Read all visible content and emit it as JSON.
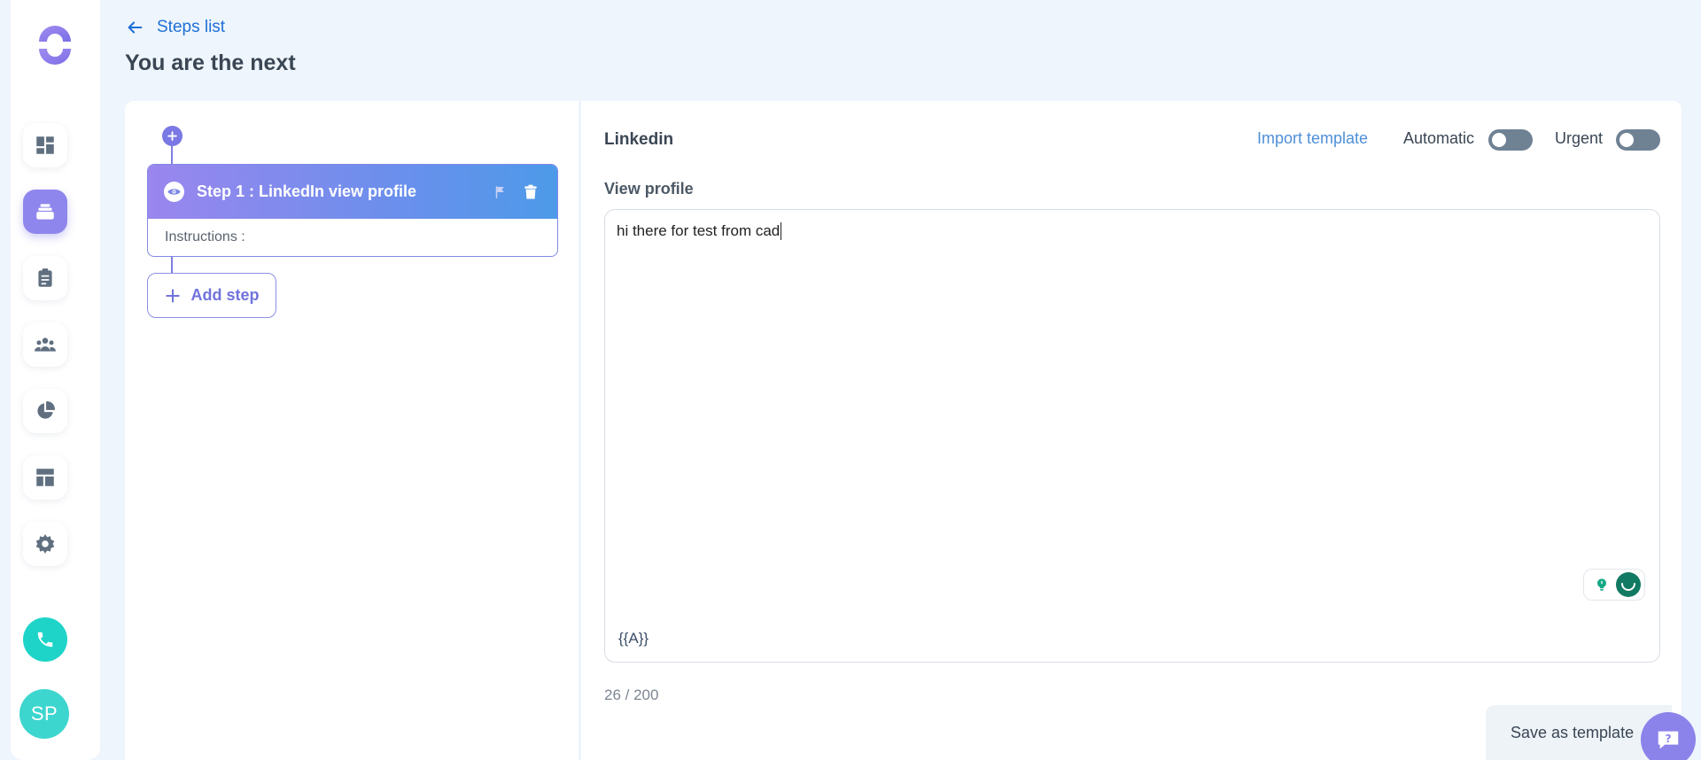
{
  "header": {
    "back_label": "Steps list",
    "title": "You are the next"
  },
  "sidebar": {
    "items": [
      {
        "name": "dashboard-icon",
        "active": false
      },
      {
        "name": "sequences-icon",
        "active": true
      },
      {
        "name": "tasks-icon",
        "active": false
      },
      {
        "name": "contacts-icon",
        "active": false
      },
      {
        "name": "reports-icon",
        "active": false
      },
      {
        "name": "templates-icon",
        "active": false
      },
      {
        "name": "settings-icon",
        "active": false
      }
    ],
    "avatar_initials": "SP"
  },
  "steps": {
    "items": [
      {
        "title": "Step 1 : LinkedIn view profile",
        "instructions_label": "Instructions :"
      }
    ],
    "add_step_label": "Add step"
  },
  "editor": {
    "channel": "Linkedin",
    "import_template_label": "Import template",
    "automatic_label": "Automatic",
    "automatic_on": false,
    "urgent_label": "Urgent",
    "urgent_on": false,
    "field_label": "View profile",
    "message": "hi there for test from cad",
    "variable_label": "{{A}}",
    "counter": "26 / 200",
    "save_template_label": "Save as template"
  },
  "colors": {
    "accent": "#8e86ec",
    "link": "#1f6fd6",
    "teal": "#1ed4c9",
    "background": "#eef5fc"
  }
}
